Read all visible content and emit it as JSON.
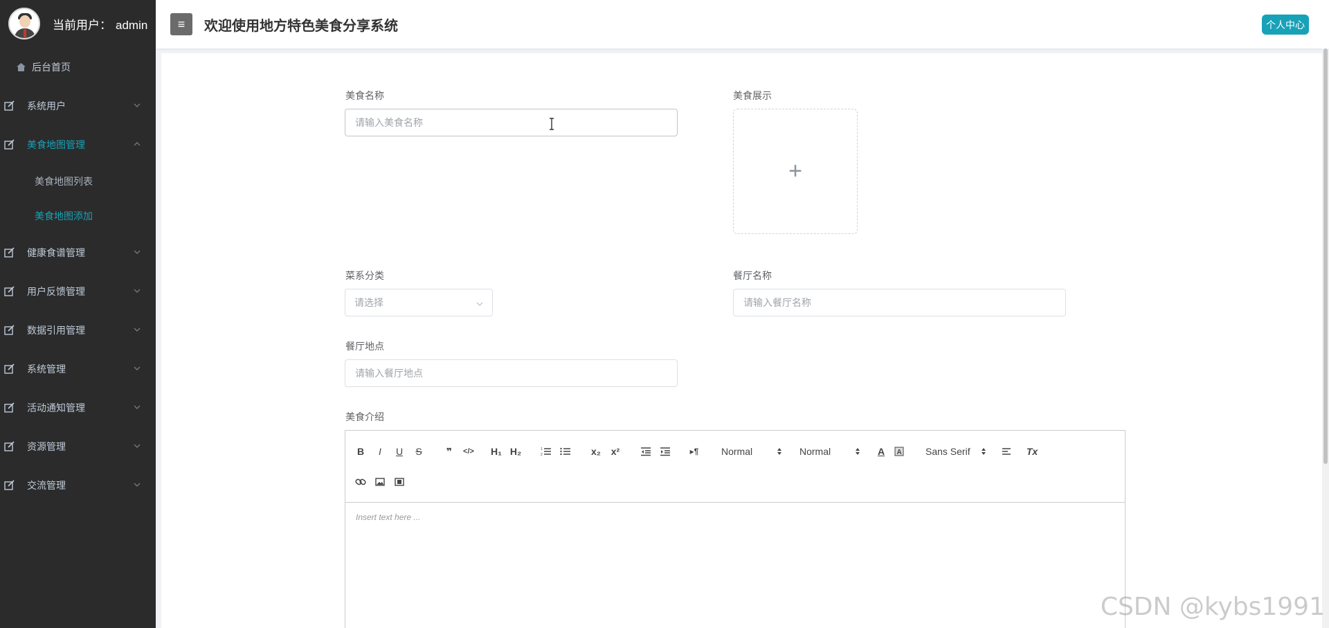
{
  "sidebar": {
    "current_user_label": "当前用户：",
    "username": "admin",
    "home_label": "后台首页",
    "menu": [
      {
        "label": "系统用户",
        "expanded": false
      },
      {
        "label": "美食地图管理",
        "expanded": true,
        "children": [
          "美食地图列表",
          "美食地图添加"
        ]
      },
      {
        "label": "健康食谱管理",
        "expanded": false
      },
      {
        "label": "用户反馈管理",
        "expanded": false
      },
      {
        "label": "数据引用管理",
        "expanded": false
      },
      {
        "label": "系统管理",
        "expanded": false
      },
      {
        "label": "活动通知管理",
        "expanded": false
      },
      {
        "label": "资源管理",
        "expanded": false
      },
      {
        "label": "交流管理",
        "expanded": false
      }
    ],
    "active_submenu": "美食地图添加"
  },
  "header": {
    "menu_toggle_glyph": "≡",
    "title": "欢迎使用地方特色美食分享系统",
    "personal_center": "个人中心"
  },
  "form": {
    "food_name": {
      "label": "美食名称",
      "placeholder": "请输入美食名称",
      "value": ""
    },
    "food_display": {
      "label": "美食展示",
      "upload_glyph": "+"
    },
    "cuisine": {
      "label": "菜系分类",
      "placeholder": "请选择"
    },
    "restaurant_name": {
      "label": "餐厅名称",
      "placeholder": "请输入餐厅名称",
      "value": ""
    },
    "restaurant_location": {
      "label": "餐厅地点",
      "placeholder": "请输入餐厅地点",
      "value": ""
    },
    "food_intro": {
      "label": "美食介绍"
    }
  },
  "editor": {
    "toolbar": {
      "bold": "B",
      "italic": "I",
      "underline": "U",
      "strike": "S",
      "blockquote": "❞",
      "code": "</>",
      "h1": "H₁",
      "h2": "H₂",
      "ordered_list": "ordered-list-icon",
      "bullet_list": "bullet-list-icon",
      "subscript": "x₂",
      "superscript": "x²",
      "outdent": "outdent-icon",
      "indent": "indent-icon",
      "direction": "▸¶",
      "size_select": "Normal",
      "header_select": "Normal",
      "color": "A",
      "background": "background-color-icon",
      "font_select": "Sans Serif",
      "align": "align-icon",
      "clean": "Tx",
      "link": "link-icon",
      "image": "image-icon",
      "video": "video-icon"
    },
    "placeholder": "Insert text here ..."
  },
  "watermark": "CSDN @kybs1991",
  "colors": {
    "sidebar_bg": "#2b2b2b",
    "accent": "#17a2b8",
    "menu_text": "#bfcbd9"
  }
}
